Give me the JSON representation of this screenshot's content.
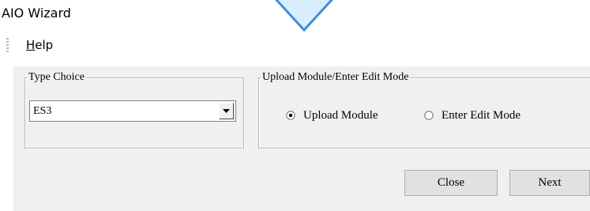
{
  "window": {
    "title": "AIO Wizard"
  },
  "menu": {
    "help_mnemonic": "H",
    "help_rest": "elp"
  },
  "type_choice": {
    "legend": "Type Choice",
    "selected_value": "ES3"
  },
  "upload_mode": {
    "legend": "Upload Module/Enter Edit Mode",
    "options": [
      {
        "label": "Upload Module",
        "selected": true
      },
      {
        "label": "Enter Edit Mode",
        "selected": false
      }
    ]
  },
  "buttons": {
    "close_label": "Close",
    "next_label": "Next"
  },
  "colors": {
    "dialog_background": "#f0f0f0",
    "arrow_fill": "#d8eefd",
    "arrow_stroke": "#3f8fd8"
  },
  "icons": {
    "arrow": "down-arrow-icon",
    "dropdown": "chevron-down-icon",
    "radio_on": "radio-selected-icon",
    "radio_off": "radio-unselected-icon"
  }
}
